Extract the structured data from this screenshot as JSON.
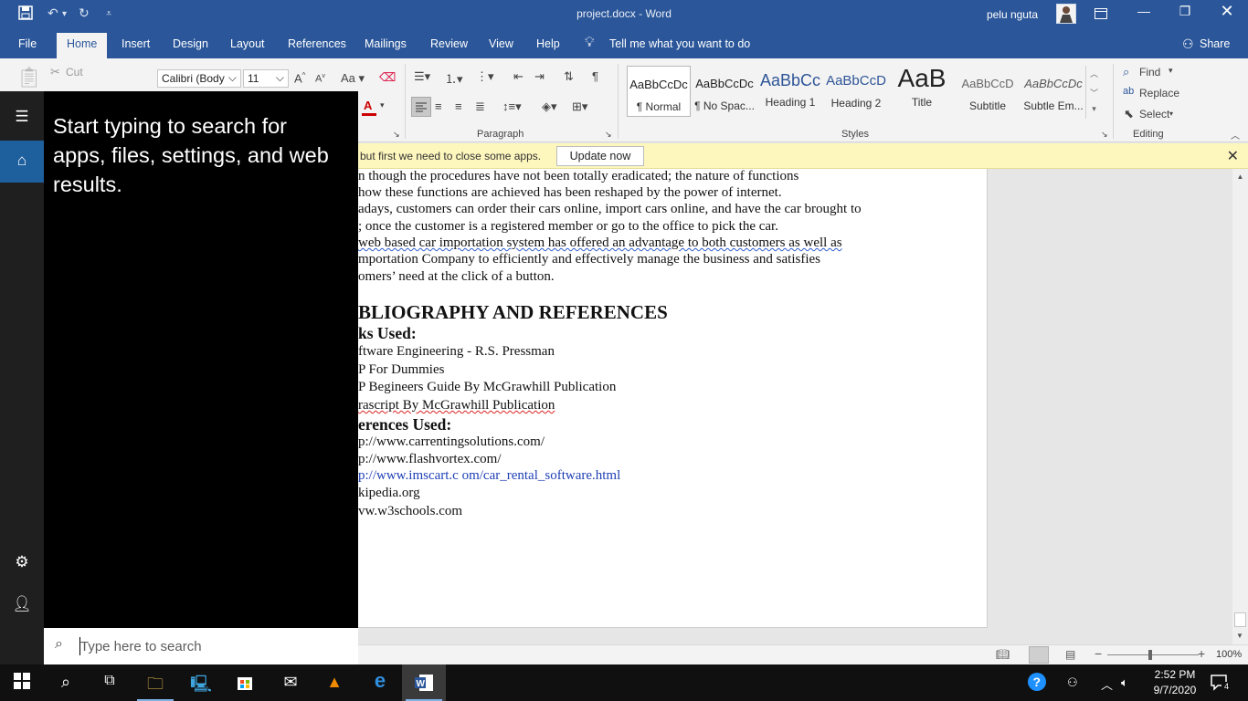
{
  "window": {
    "title": "project.docx  -  Word",
    "user": "pelu nguta"
  },
  "tabs": [
    "File",
    "Home",
    "Insert",
    "Design",
    "Layout",
    "References",
    "Mailings",
    "Review",
    "View",
    "Help"
  ],
  "tell_me": "Tell me what you want to do",
  "share": "Share",
  "ribbon": {
    "cut": "Cut",
    "font_name": "Calibri (Body",
    "font_size": "11",
    "paragraph_label": "Paragraph",
    "styles_label": "Styles",
    "editing_label": "Editing",
    "styles": [
      {
        "sample": "AaBbCcDc",
        "label": "¶ Normal"
      },
      {
        "sample": "AaBbCcDc",
        "label": "¶ No Spac..."
      },
      {
        "sample": "AaBbCc",
        "label": "Heading 1"
      },
      {
        "sample": "AaBbCcD",
        "label": "Heading 2"
      },
      {
        "sample": "AaB",
        "label": "Title"
      },
      {
        "sample": "AaBbCcD",
        "label": "Subtitle"
      },
      {
        "sample": "AaBbCcDc",
        "label": "Subtle Em..."
      }
    ],
    "find": "Find",
    "replace": "Replace",
    "select": "Select"
  },
  "notice": {
    "message": "but first we need to close some apps.",
    "button": "Update now"
  },
  "document": {
    "lines": [
      "n though the procedures have not been totally eradicated; the nature of functions",
      "how these functions are achieved has been reshaped by the power of internet.",
      "adays, customers can order their cars online, import cars online, and have the car brought to",
      "; once the customer is a registered member or go to the office to pick the car.",
      "web based car importation system has offered an advantage to both customers as well as",
      "mportation Company to efficiently and effectively manage the business and satisfies",
      "omers’ need at the click of a button."
    ],
    "heading": "BLIOGRAPHY AND REFERENCES",
    "books_heading": "ks Used:",
    "books": [
      "ftware Engineering - R.S. Pressman",
      "P For Dummies",
      "P Begineers Guide By McGrawhill Publication",
      "rascript By McGrawhill Publication"
    ],
    "refs_heading": "erences Used:",
    "refs": [
      "p://www.carrentingsolutions.com/",
      "p://www.flashvortex.com/",
      "p://www.imscart.c om/car_rental_software.html",
      "kipedia.org",
      "vw.w3schools.com"
    ]
  },
  "statusbar": {
    "zoom": "100%"
  },
  "startmenu": {
    "hint": "Start typing to search for apps, files, settings, and web results.",
    "search_placeholder": "Type here to search"
  },
  "taskbar": {
    "time": "2:52 PM",
    "date": "9/7/2020",
    "notifications": "4"
  }
}
